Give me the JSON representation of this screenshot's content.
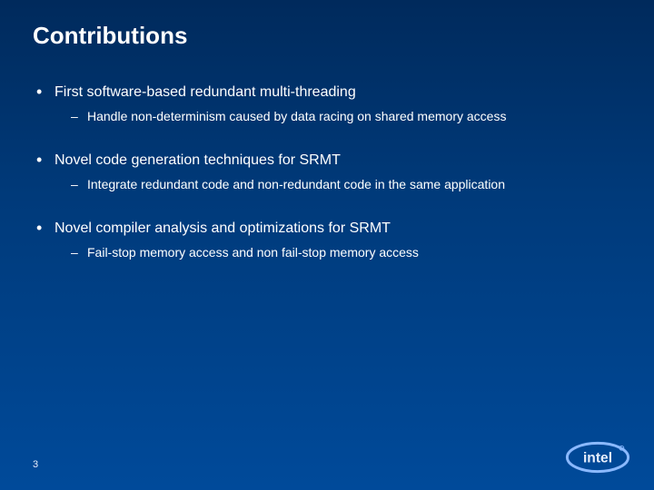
{
  "title": "Contributions",
  "bullets": [
    {
      "text": "First software-based redundant multi-threading",
      "sub": [
        "Handle non-determinism caused by data racing on shared memory access"
      ]
    },
    {
      "text": "Novel code generation techniques for SRMT",
      "sub": [
        "Integrate redundant code and non-redundant code in the same application"
      ]
    },
    {
      "text": "Novel compiler analysis and optimizations for SRMT",
      "sub": [
        "Fail-stop memory access and non fail-stop memory access"
      ]
    }
  ],
  "pageNumber": "3",
  "logo": "intel"
}
